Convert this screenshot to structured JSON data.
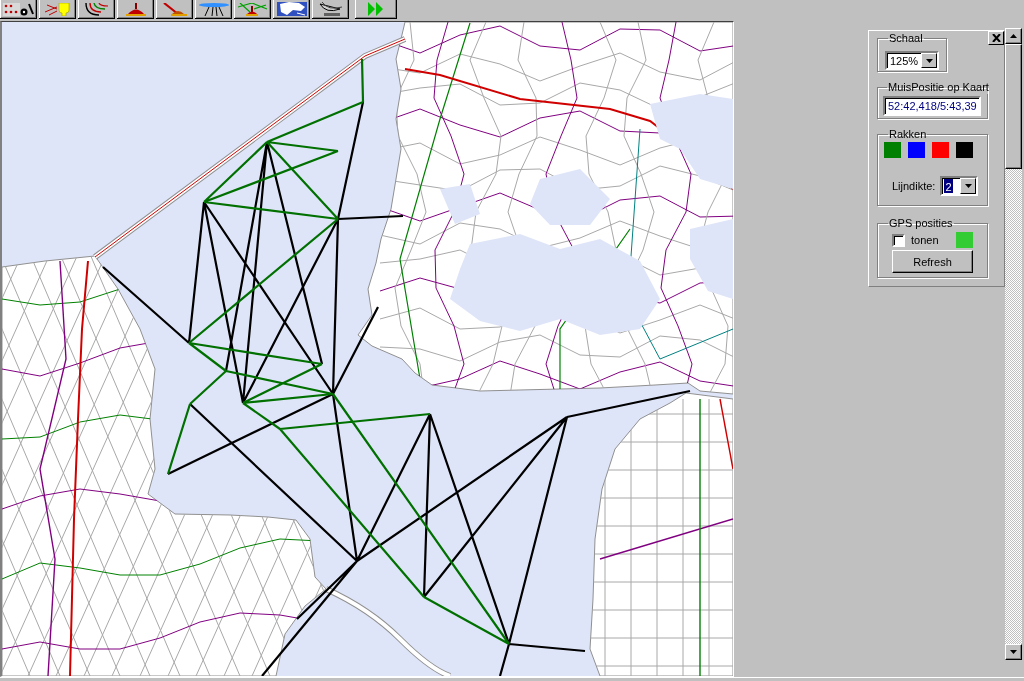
{
  "toolbar": {
    "buttons": [
      {
        "kind": "dots"
      },
      {
        "kind": "lightbulb"
      },
      {
        "kind": "curves"
      },
      {
        "kind": "buoy"
      },
      {
        "kind": "pole"
      },
      {
        "kind": "beam"
      },
      {
        "kind": "route"
      },
      {
        "kind": "map"
      },
      {
        "kind": "dish"
      },
      {
        "kind": "play"
      }
    ]
  },
  "panel": {
    "schaal": {
      "label": "Schaal",
      "value": "125%"
    },
    "muispositie": {
      "label": "MuisPositie op Kaart",
      "value": "52:42,418/5:43,39"
    },
    "rakken": {
      "label": "Rakken",
      "colors": [
        {
          "color": "#008000"
        },
        {
          "color": "#0000ff"
        },
        {
          "color": "#ff0000"
        },
        {
          "color": "#000000"
        }
      ],
      "lijndikte": {
        "label": "Lijndikte:",
        "value": "2",
        "focused": true
      }
    },
    "gps": {
      "label": "GPS posities",
      "checkbox": {
        "label": "tonen",
        "checked": false
      },
      "color": "#33cc33",
      "button": "Refresh"
    }
  }
}
